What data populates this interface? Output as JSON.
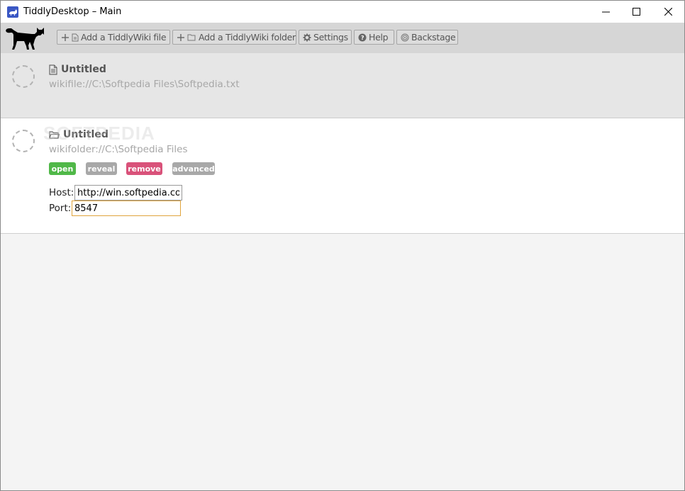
{
  "window": {
    "title": "TiddlyDesktop – Main"
  },
  "toolbar": {
    "add_file_label": "Add a TiddlyWiki file",
    "add_folder_label": "Add a TiddlyWiki folder",
    "settings_label": "Settings",
    "help_label": "Help",
    "backstage_label": "Backstage"
  },
  "wikis": [
    {
      "kind": "file",
      "title": "Untitled",
      "url": "wikifile://C:\\Softpedia Files\\Softpedia.txt"
    },
    {
      "kind": "folder",
      "title": "Untitled",
      "url": "wikifolder://C:\\Softpedia Files",
      "actions": {
        "open": "open",
        "reveal": "reveal",
        "remove": "remove",
        "advanced": "advanced"
      },
      "host_label": "Host:",
      "host_value": "http://win.softpedia.com",
      "port_label": "Port:",
      "port_value": "8547"
    }
  ],
  "watermark": "SOFTPEDIA",
  "colors": {
    "open": "#50b848",
    "reveal": "#a8a8a8",
    "remove": "#d9527a",
    "advanced": "#a8a8a8",
    "toolbar_bg": "#d6d6d6",
    "port_focus_border": "#e0a43c"
  }
}
